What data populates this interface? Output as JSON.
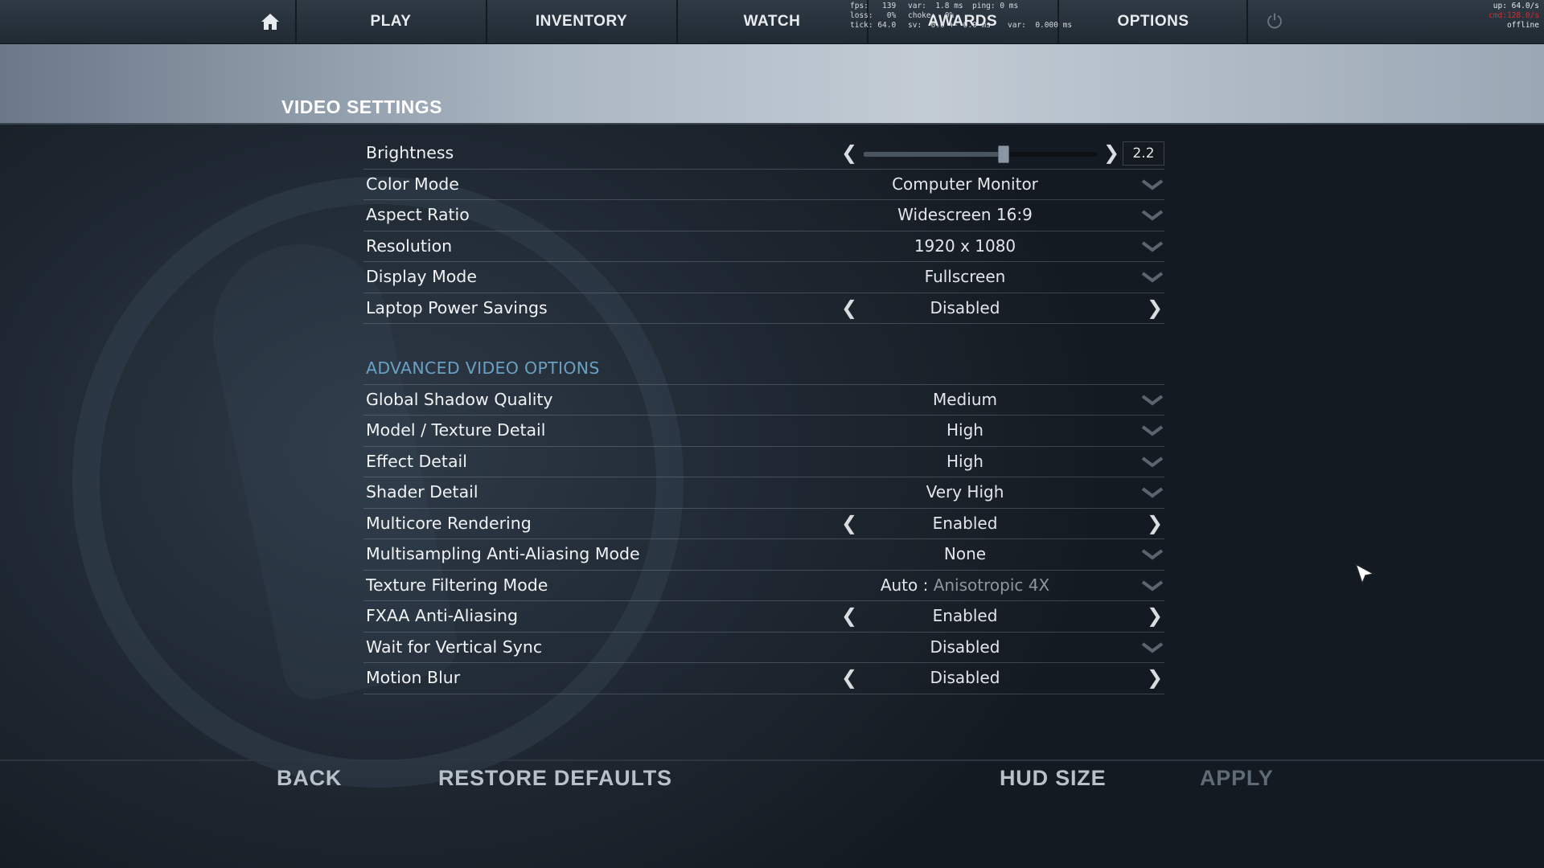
{
  "nav": {
    "tabs": [
      "PLAY",
      "INVENTORY",
      "WATCH",
      "AWARDS",
      "OPTIONS"
    ],
    "netgraph": {
      "fps": "fps:   139",
      "loss": "loss:   0%",
      "tick": "tick: 64.0",
      "var1": "var:  1.8 ms",
      "choke": "choke:  0%",
      "sv": "sv:  0.0 +- 0.0 ms",
      "ping": "ping: 0 ms",
      "var2": "var:  0.000 ms"
    },
    "corner_stats": {
      "up": "up: 64.0/s",
      "cmd": "cmd:128.0/s",
      "status": "offline"
    }
  },
  "page_title": "VIDEO SETTINGS",
  "settings": [
    {
      "label": "Brightness",
      "value": "2.2",
      "slider_fraction": 0.6
    },
    {
      "label": "Color Mode",
      "value": "Computer Monitor"
    },
    {
      "label": "Aspect Ratio",
      "value": "Widescreen 16:9"
    },
    {
      "label": "Resolution",
      "value": "1920 x 1080"
    },
    {
      "label": "Display Mode",
      "value": "Fullscreen"
    },
    {
      "label": "Laptop Power Savings",
      "value": "Disabled"
    }
  ],
  "advanced": {
    "title": "ADVANCED VIDEO OPTIONS",
    "rows": [
      {
        "label": "Global Shadow Quality",
        "value": "Medium"
      },
      {
        "label": "Model / Texture Detail",
        "value": "High"
      },
      {
        "label": "Effect Detail",
        "value": "High"
      },
      {
        "label": "Shader Detail",
        "value": "Very High"
      },
      {
        "label": "Multicore Rendering",
        "value": "Enabled"
      },
      {
        "label": "Multisampling Anti-Aliasing Mode",
        "value": "None"
      },
      {
        "label": "Texture Filtering Mode",
        "value_prefix": "Auto : ",
        "value": "Anisotropic 4X"
      },
      {
        "label": "FXAA Anti-Aliasing",
        "value": "Enabled"
      },
      {
        "label": "Wait for Vertical Sync",
        "value": "Disabled"
      },
      {
        "label": "Motion Blur",
        "value": "Disabled"
      }
    ]
  },
  "bottom": {
    "back": "BACK",
    "restore": "RESTORE DEFAULTS",
    "hud": "HUD SIZE",
    "apply": "APPLY"
  },
  "colors": {
    "accent": "#6aa0c2",
    "corner_cmd": "#e0262a"
  }
}
